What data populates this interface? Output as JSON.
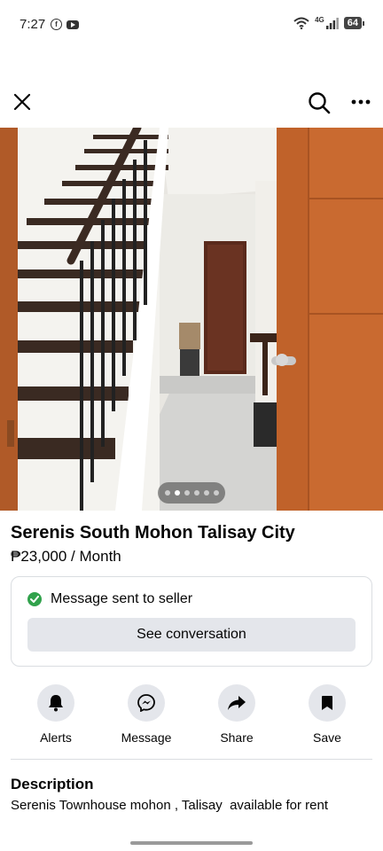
{
  "status_bar": {
    "time": "7:27",
    "network": "4G",
    "battery": "64",
    "app_icons": [
      "facebook-icon",
      "youtube-icon"
    ]
  },
  "topbar": {
    "icons": [
      "close-icon",
      "search-icon",
      "more-icon"
    ]
  },
  "photo": {
    "slide_count": 6,
    "active_slide": 2
  },
  "listing": {
    "title": "Serenis South Mohon Talisay City",
    "price": "₱23,000 / Month"
  },
  "message_card": {
    "status_text": "Message sent to seller",
    "button_label": "See conversation",
    "status_color": "#31a24c"
  },
  "actions": [
    {
      "label": "Alerts",
      "icon": "bell-icon"
    },
    {
      "label": "Message",
      "icon": "messenger-icon"
    },
    {
      "label": "Share",
      "icon": "share-icon"
    },
    {
      "label": "Save",
      "icon": "bookmark-icon"
    }
  ],
  "description": {
    "heading": "Description",
    "text": "Serenis Townhouse mohon , Talisay  available for rent"
  }
}
